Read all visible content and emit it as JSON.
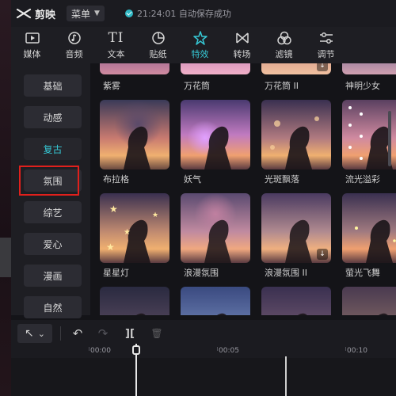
{
  "app": {
    "name": "剪映",
    "menu_label": "菜单",
    "save_status": "21:24:01 自动保存成功"
  },
  "toolbar": {
    "tabs": [
      {
        "label": "媒体",
        "icon": "media-icon"
      },
      {
        "label": "音频",
        "icon": "audio-icon"
      },
      {
        "label": "文本",
        "icon": "text-icon",
        "glyph": "TI"
      },
      {
        "label": "贴纸",
        "icon": "sticker-icon"
      },
      {
        "label": "特效",
        "icon": "effects-icon",
        "active": true
      },
      {
        "label": "转场",
        "icon": "transition-icon"
      },
      {
        "label": "滤镜",
        "icon": "filter-icon"
      },
      {
        "label": "调节",
        "icon": "adjust-icon"
      }
    ]
  },
  "sidebar": {
    "categories": [
      {
        "label": "基础"
      },
      {
        "label": "动感"
      },
      {
        "label": "复古",
        "active": true
      },
      {
        "label": "氛围",
        "highlighted": true
      },
      {
        "label": "综艺"
      },
      {
        "label": "爱心"
      },
      {
        "label": "漫画"
      },
      {
        "label": "自然"
      }
    ]
  },
  "effects": {
    "rows": [
      [
        {
          "label": "紫雾"
        },
        {
          "label": "万花筒"
        },
        {
          "label": "万花筒 II",
          "download": true
        },
        {
          "label": "神明少女"
        }
      ],
      [
        {
          "label": "布拉格"
        },
        {
          "label": "妖气"
        },
        {
          "label": "光斑飘落"
        },
        {
          "label": "流光溢彩"
        }
      ],
      [
        {
          "label": "星星灯"
        },
        {
          "label": "浪漫氛围"
        },
        {
          "label": "浪漫氛围 II",
          "download": true
        },
        {
          "label": "萤光飞舞"
        }
      ],
      [
        {
          "label": ""
        },
        {
          "label": ""
        },
        {
          "label": ""
        },
        {
          "label": ""
        }
      ]
    ],
    "download_glyph": "↓"
  },
  "timeline": {
    "tools": {
      "select_glyph": "↖",
      "select_chev": "⌄",
      "undo_glyph": "↶",
      "redo_glyph": "↷",
      "split_glyph": "][",
      "delete_glyph": "🗑"
    },
    "ruler": [
      "00:00",
      "00:05",
      "00:10"
    ]
  },
  "colors": {
    "accent": "#36c7d4",
    "highlight_box": "#e0201c",
    "panel_bg": "#1e1e23"
  }
}
